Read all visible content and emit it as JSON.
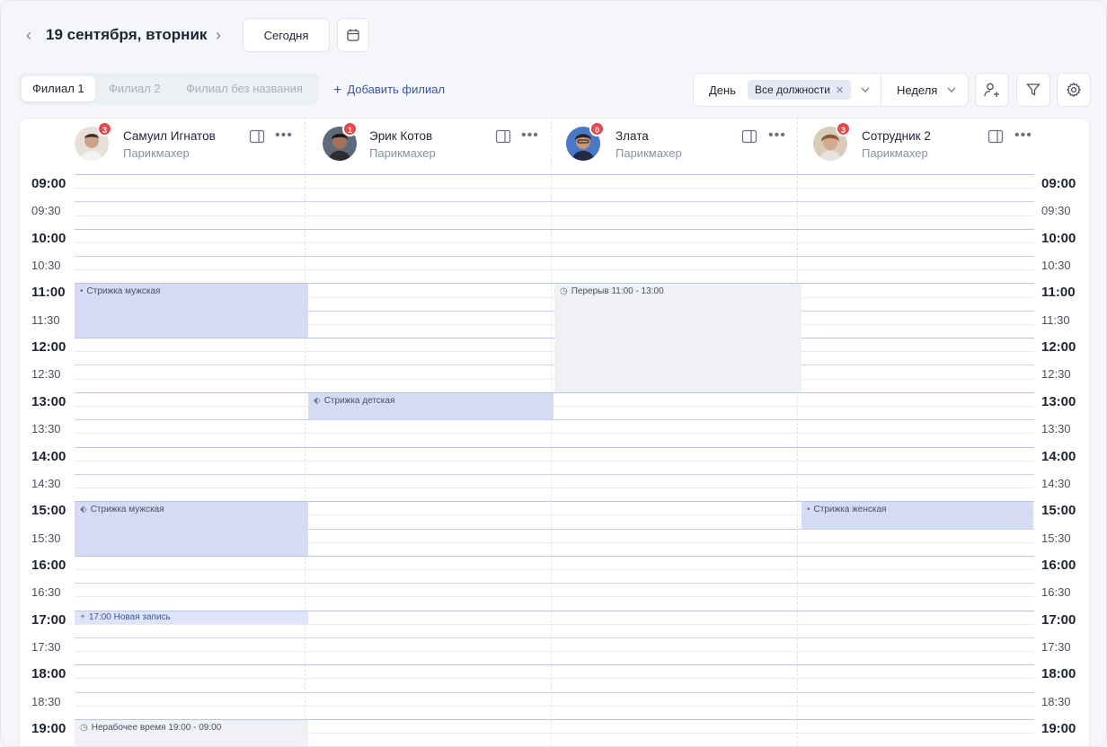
{
  "header": {
    "date_title": "19 сентября, вторник",
    "prev_icon": "chevron-left-icon",
    "next_icon": "chevron-right-icon",
    "today_label": "Сегодня",
    "calendar_icon": "calendar-icon"
  },
  "branches": {
    "tabs": [
      {
        "label": "Филиал 1",
        "active": true
      },
      {
        "label": "Филиал 2",
        "active": false
      },
      {
        "label": "Филиал без названия",
        "active": false
      }
    ],
    "add_label": "Добавить филиал"
  },
  "filters": {
    "day_label": "День",
    "positions_chip": "Все должности",
    "week_label": "Неделя",
    "add_employee_icon": "add-user-icon",
    "filter_icon": "filter-icon",
    "settings_icon": "gear-icon"
  },
  "staff": [
    {
      "name": "Самуил Игнатов",
      "role": "Парикмахер",
      "badge": "3"
    },
    {
      "name": "Эрик Котов",
      "role": "Парикмахер",
      "badge": "1"
    },
    {
      "name": "Злата",
      "role": "Парикмахер",
      "badge": "0"
    },
    {
      "name": "Сотрудник 2",
      "role": "Парикмахер",
      "badge": "3"
    }
  ],
  "times": [
    "09:00",
    "09:30",
    "10:00",
    "10:30",
    "11:00",
    "11:30",
    "12:00",
    "12:30",
    "13:00",
    "13:30",
    "14:00",
    "14:30",
    "15:00",
    "15:30",
    "16:00",
    "16:30",
    "17:00",
    "17:30",
    "18:00",
    "18:30",
    "19:00"
  ],
  "events": [
    {
      "staff": 0,
      "label": "Стрижка мужская",
      "start": "11:00",
      "end": "12:00",
      "kind": "booked",
      "icon": "dot"
    },
    {
      "staff": 2,
      "label": "Перерыв 11:00 - 13:00",
      "start": "11:00",
      "end": "13:00",
      "kind": "break",
      "icon": "clock-icon"
    },
    {
      "staff": 1,
      "label": "Стрижка детская",
      "start": "13:00",
      "end": "13:30",
      "kind": "booked",
      "icon": "tag-icon"
    },
    {
      "staff": 0,
      "label": "Стрижка мужская",
      "start": "15:00",
      "end": "16:00",
      "kind": "booked",
      "icon": "tag-icon"
    },
    {
      "staff": 3,
      "label": "Стрижка женская",
      "start": "15:00",
      "end": "15:30",
      "kind": "booked",
      "icon": "dot"
    },
    {
      "staff": 0,
      "label": "17:00 Новая запись",
      "start": "17:00",
      "end": "17:15",
      "kind": "new",
      "icon": "plus-icon"
    },
    {
      "staff": 0,
      "label": "Нерабочее время 19:00 - 09:00",
      "start": "19:00",
      "end": "19:30",
      "kind": "break",
      "icon": "clock-icon"
    }
  ]
}
